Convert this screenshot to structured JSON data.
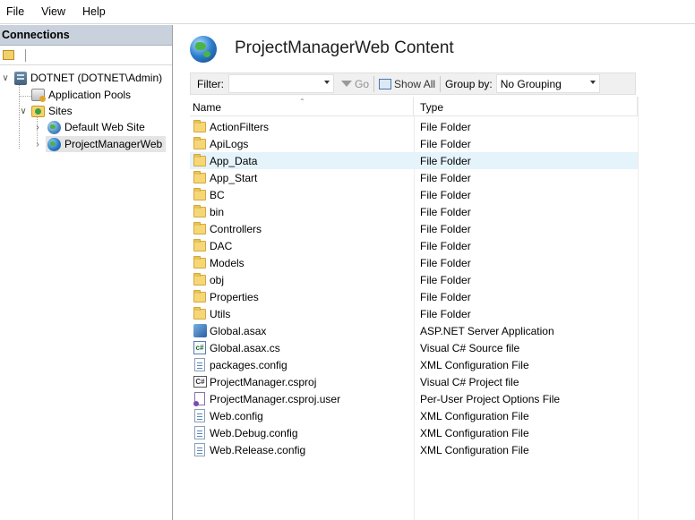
{
  "menu": {
    "file": "File",
    "view": "View",
    "help": "Help"
  },
  "connections": {
    "title": "Connections",
    "tree": {
      "server": "DOTNET (DOTNET\\Admin)",
      "app_pools": "Application Pools",
      "sites": "Sites",
      "default_site": "Default Web Site",
      "project_site": "ProjectManagerWeb"
    }
  },
  "content": {
    "title": "ProjectManagerWeb Content",
    "filter_label": "Filter:",
    "filter_value": "",
    "go_label": "Go",
    "show_all_label": "Show All",
    "group_by_label": "Group by:",
    "group_by_value": "No Grouping",
    "columns": {
      "name": "Name",
      "type": "Type"
    },
    "rows": [
      {
        "name": "ActionFilters",
        "type": "File Folder",
        "icon": "folder-icon"
      },
      {
        "name": "ApiLogs",
        "type": "File Folder",
        "icon": "folder-icon"
      },
      {
        "name": "App_Data",
        "type": "File Folder",
        "icon": "folder-icon"
      },
      {
        "name": "App_Start",
        "type": "File Folder",
        "icon": "folder-icon"
      },
      {
        "name": "BC",
        "type": "File Folder",
        "icon": "folder-icon"
      },
      {
        "name": "bin",
        "type": "File Folder",
        "icon": "folder-icon"
      },
      {
        "name": "Controllers",
        "type": "File Folder",
        "icon": "folder-icon"
      },
      {
        "name": "DAC",
        "type": "File Folder",
        "icon": "folder-icon"
      },
      {
        "name": "Models",
        "type": "File Folder",
        "icon": "folder-icon"
      },
      {
        "name": "obj",
        "type": "File Folder",
        "icon": "folder-icon"
      },
      {
        "name": "Properties",
        "type": "File Folder",
        "icon": "folder-icon"
      },
      {
        "name": "Utils",
        "type": "File Folder",
        "icon": "folder-icon"
      },
      {
        "name": "Global.asax",
        "type": "ASP.NET Server Application",
        "icon": "asax-icon"
      },
      {
        "name": "Global.asax.cs",
        "type": "Visual C# Source file",
        "icon": "cs-file-icon"
      },
      {
        "name": "packages.config",
        "type": "XML Configuration File",
        "icon": "config-file-icon"
      },
      {
        "name": "ProjectManager.csproj",
        "type": "Visual C# Project file",
        "icon": "csproj-icon"
      },
      {
        "name": "ProjectManager.csproj.user",
        "type": "Per-User Project Options File",
        "icon": "user-file-icon"
      },
      {
        "name": "Web.config",
        "type": "XML Configuration File",
        "icon": "config-file-icon"
      },
      {
        "name": "Web.Debug.config",
        "type": "XML Configuration File",
        "icon": "config-file-icon"
      },
      {
        "name": "Web.Release.config",
        "type": "XML Configuration File",
        "icon": "config-file-icon"
      }
    ]
  }
}
